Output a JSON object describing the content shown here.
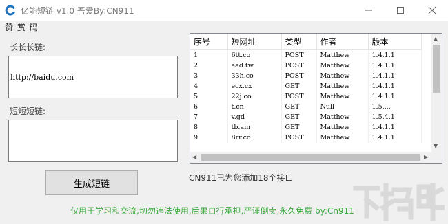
{
  "window": {
    "title": "亿能短链 v1.0 吾爱By:CN911",
    "accent": "#1e73be"
  },
  "menu": {
    "label": "赞 赏 码"
  },
  "long_link": {
    "label": "长长长链:",
    "value": "http://baidu.com"
  },
  "short_link": {
    "label": "短短短链:",
    "value": ""
  },
  "generate_button": {
    "label": "生成短链"
  },
  "table": {
    "columns": [
      "序号",
      "短网址",
      "类型",
      "作者",
      "版本"
    ],
    "rows": [
      [
        "1",
        "6tt.co",
        "POST",
        "Matthew",
        "1.4.1.1"
      ],
      [
        "2",
        "aad.tw",
        "POST",
        "Matthew",
        "1.4.1.1"
      ],
      [
        "3",
        "33h.co",
        "POST",
        "Matthew",
        "1.4.1.1"
      ],
      [
        "4",
        "ecx.cx",
        "GET",
        "Matthew",
        "1.4.1.1"
      ],
      [
        "5",
        "22j.co",
        "POST",
        "Matthew",
        "1.4.1.1"
      ],
      [
        "6",
        "t.cn",
        "GET",
        "Null",
        "1.5...."
      ],
      [
        "7",
        "v.gd",
        "GET",
        "Matthew",
        "1.5.4.1"
      ],
      [
        "8",
        "tb.am",
        "GET",
        "Matthew",
        "1.4.1.1"
      ],
      [
        "9",
        "8rr.co",
        "POST",
        "Matthew",
        "1.4.1.1"
      ]
    ],
    "scroll": {
      "vertical_position": 0.0,
      "horizontal_position": 0.0
    }
  },
  "status": "CN911已为您添加18个接口",
  "footer": "仅用于学习和交流,切勿违法使用,后果自行承担,严谨倒卖,永久免费 by:Cn911",
  "watermark": {
    "text": "下载吧",
    "color": "#d8d8d8"
  }
}
